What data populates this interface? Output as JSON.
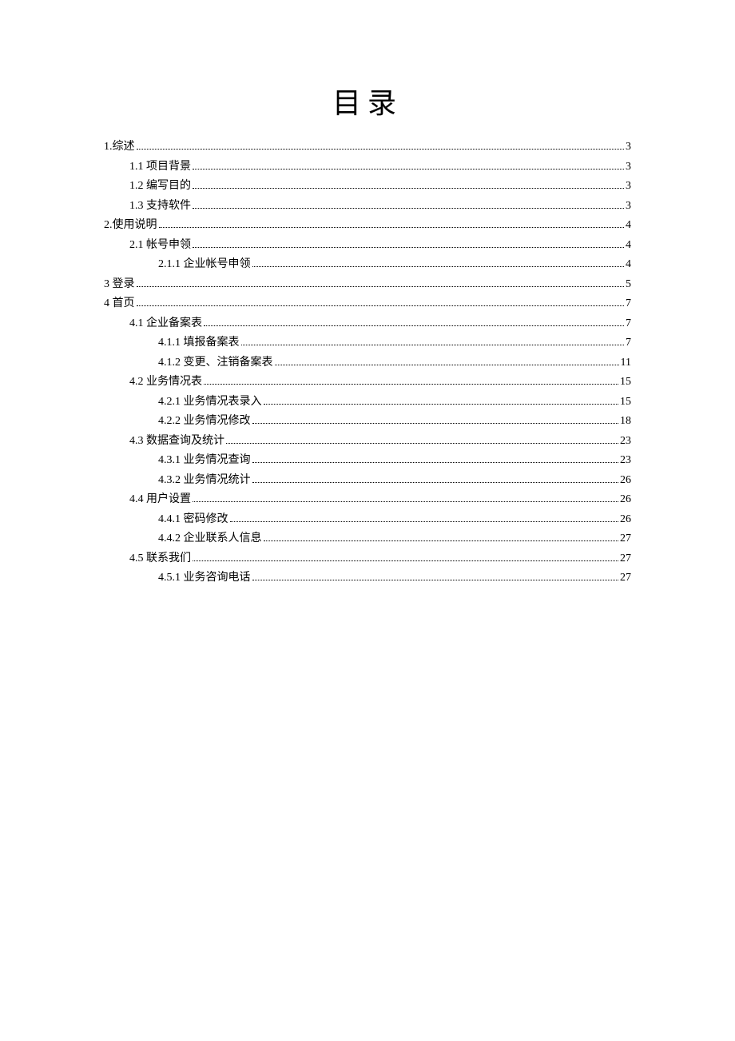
{
  "title": "目录",
  "entries": [
    {
      "level": 0,
      "label": "1.综述",
      "page": "3"
    },
    {
      "level": 1,
      "label": "1.1 项目背景",
      "page": "3"
    },
    {
      "level": 1,
      "label": "1.2 编写目的",
      "page": "3"
    },
    {
      "level": 1,
      "label": "1.3 支持软件",
      "page": "3"
    },
    {
      "level": 0,
      "label": "2.使用说明",
      "page": "4"
    },
    {
      "level": 1,
      "label": "2.1 帐号申领",
      "page": "4"
    },
    {
      "level": 2,
      "label": "2.1.1 企业帐号申领",
      "page": "4"
    },
    {
      "level": 0,
      "label": "3 登录",
      "page": "5"
    },
    {
      "level": 0,
      "label": "4 首页",
      "page": "7"
    },
    {
      "level": 1,
      "label": "4.1 企业备案表",
      "page": "7"
    },
    {
      "level": 2,
      "label": "4.1.1 填报备案表",
      "page": "7"
    },
    {
      "level": 2,
      "label": "4.1.2 变更、注销备案表",
      "page": "11"
    },
    {
      "level": 1,
      "label": "4.2 业务情况表",
      "page": "15"
    },
    {
      "level": 2,
      "label": "4.2.1 业务情况表录入",
      "page": "15"
    },
    {
      "level": 2,
      "label": "4.2.2 业务情况修改",
      "page": "18"
    },
    {
      "level": 1,
      "label": "4.3 数据查询及统计",
      "page": "23"
    },
    {
      "level": 2,
      "label": "4.3.1 业务情况查询",
      "page": "23"
    },
    {
      "level": 2,
      "label": "4.3.2 业务情况统计",
      "page": "26"
    },
    {
      "level": 1,
      "label": "4.4 用户设置",
      "page": "26"
    },
    {
      "level": 2,
      "label": "4.4.1 密码修改",
      "page": "26"
    },
    {
      "level": 2,
      "label": "4.4.2 企业联系人信息",
      "page": "27"
    },
    {
      "level": 1,
      "label": "4.5 联系我们",
      "page": "27"
    },
    {
      "level": 2,
      "label": "4.5.1 业务咨询电话",
      "page": "27"
    }
  ]
}
